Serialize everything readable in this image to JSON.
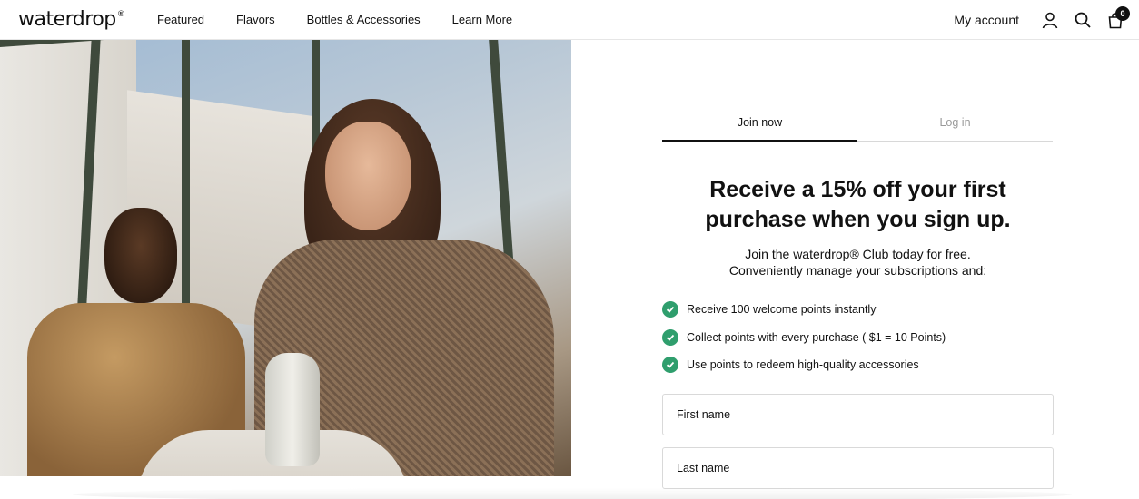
{
  "header": {
    "logo": "waterdrop",
    "logo_mark": "®",
    "nav": [
      {
        "label": "Featured"
      },
      {
        "label": "Flavors"
      },
      {
        "label": "Bottles & Accessories"
      },
      {
        "label": "Learn More"
      }
    ],
    "account_label": "My account",
    "cart_count": "0",
    "icons": [
      "user-icon",
      "search-icon",
      "bag-icon"
    ]
  },
  "hero": {
    "image_alt": "photo-of-two-people-with-waterdrop-bottle"
  },
  "auth": {
    "tabs": [
      {
        "label": "Join now",
        "active": true
      },
      {
        "label": "Log in",
        "active": false
      }
    ],
    "promo_line1": "Receive a 15% off your first",
    "promo_line2": "purchase when you sign up.",
    "intro_line1": "Join the waterdrop® Club today for free.",
    "intro_line2": "Conveniently manage your subscriptions and:",
    "benefits": [
      {
        "text": "Receive 100 welcome points instantly"
      },
      {
        "text": "Collect points with every purchase ( $1 = 10 Points)"
      },
      {
        "text": "Use points to redeem high-quality accessories"
      }
    ],
    "fields": {
      "first_name_placeholder": "First name",
      "last_name_placeholder": "Last name"
    }
  },
  "colors": {
    "accent_check": "#2f9e6d",
    "text": "#111111",
    "muted": "#9a9a9a"
  }
}
